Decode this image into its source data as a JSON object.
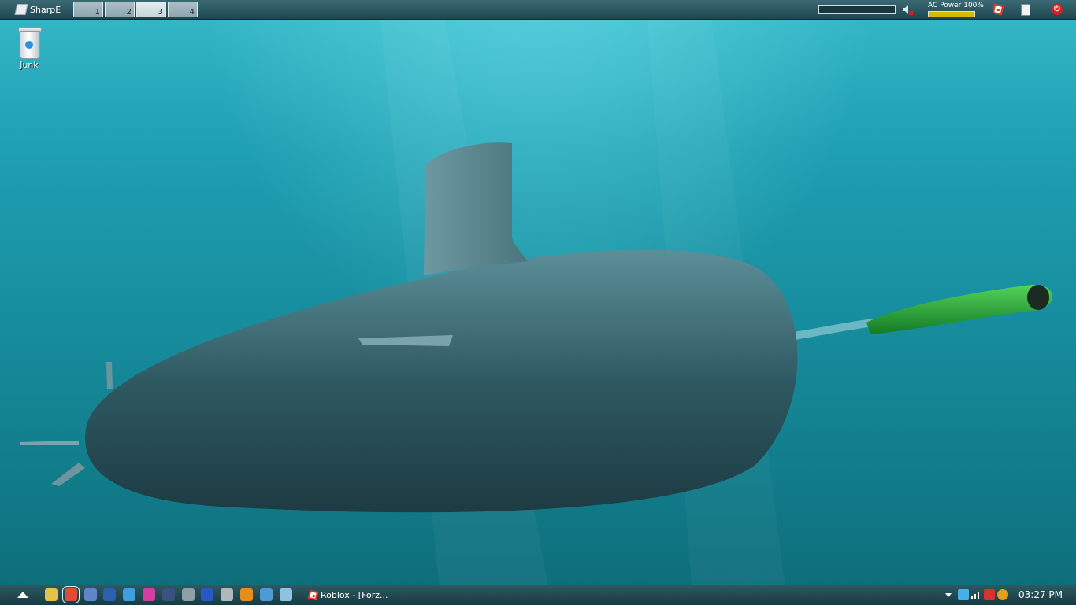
{
  "topbar": {
    "start_label": "SharpE",
    "desktops": [
      "1",
      "2",
      "3",
      "4"
    ],
    "active_desktop": "3",
    "ac_power_label": "AC Power 100%",
    "ac_power_percent": 100
  },
  "desktop": {
    "icons": [
      {
        "label": "Junk",
        "icon": "recycle-bin-icon"
      }
    ]
  },
  "taskbar": {
    "quick_launch": [
      {
        "icon": "folder-icon",
        "color": "#e7c24a"
      },
      {
        "icon": "chrome-icon",
        "color": "#e14b3a"
      },
      {
        "icon": "calculator-icon",
        "color": "#5f86c9"
      },
      {
        "icon": "photoshop-icon",
        "color": "#2b5fb0"
      },
      {
        "icon": "globe-icon",
        "color": "#3aa0e0"
      },
      {
        "icon": "messenger-icon",
        "color": "#d13fa3"
      },
      {
        "icon": "figure-icon",
        "color": "#3a5280"
      },
      {
        "icon": "network-icon",
        "color": "#8ca0a6"
      },
      {
        "icon": "app-window-icon",
        "color": "#2857c7"
      },
      {
        "icon": "gear-app-icon",
        "color": "#b0b8bb"
      },
      {
        "icon": "mozilla-icon",
        "color": "#e78c1f"
      },
      {
        "icon": "windows-explorer-icon",
        "color": "#4d9bd6"
      },
      {
        "icon": "notepad-icon",
        "color": "#8fc1e0"
      }
    ],
    "window_button": "Roblox - [Forz...",
    "clock": "03:27 PM",
    "tray": [
      {
        "icon": "pen-icon",
        "color": "#46b1e8"
      },
      {
        "icon": "signal-icon",
        "color": "#ffffff"
      },
      {
        "icon": "medical-cross-icon",
        "color": "#d93030"
      },
      {
        "icon": "swirl-icon",
        "color": "#e0a020"
      }
    ]
  }
}
